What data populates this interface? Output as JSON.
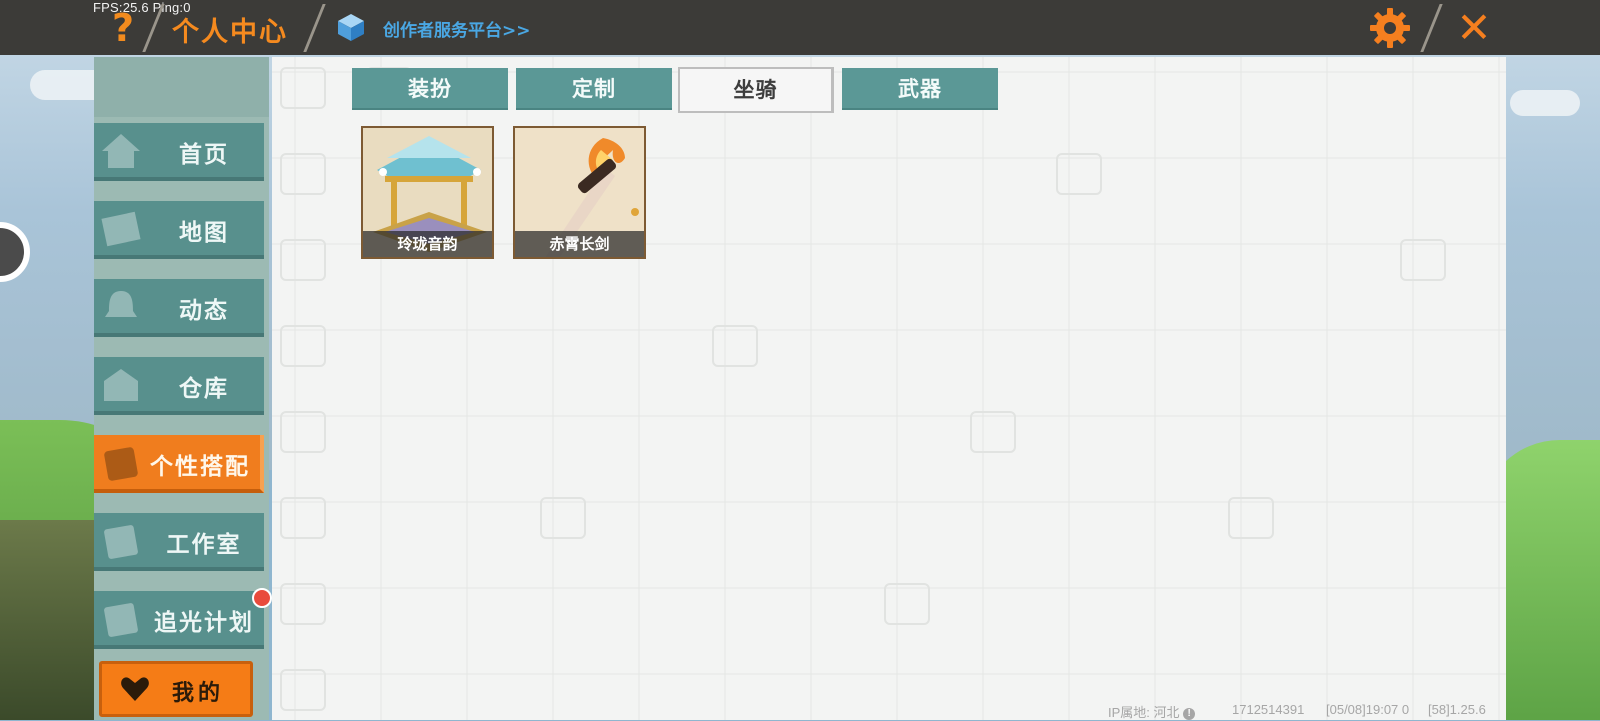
{
  "status": {
    "fps_text": "FPS:25.6  Ping:0"
  },
  "header": {
    "title": "个人中心",
    "creator_link": "创作者服务平台>>"
  },
  "sidebar": {
    "items": [
      {
        "label": "首页",
        "icon": "house-icon",
        "active": false
      },
      {
        "label": "地图",
        "icon": "picture-icon",
        "active": false
      },
      {
        "label": "动态",
        "icon": "bell-icon",
        "active": false
      },
      {
        "label": "仓库",
        "icon": "warehouse-icon",
        "active": false
      },
      {
        "label": "个性搭配",
        "icon": "avatar-icon",
        "active": true
      },
      {
        "label": "工作室",
        "icon": "studio-icon",
        "active": false
      },
      {
        "label": "追光计划",
        "icon": "light-plan-icon",
        "active": false,
        "badge": "red-dot"
      }
    ],
    "mine_button": "我的"
  },
  "tabs": [
    {
      "label": "装扮",
      "active": false
    },
    {
      "label": "定制",
      "active": false
    },
    {
      "label": "坐骑",
      "active": true
    },
    {
      "label": "武器",
      "active": false
    }
  ],
  "items": [
    {
      "name": "玲珑音韵"
    },
    {
      "name": "赤霄长剑"
    }
  ],
  "footer": {
    "ip_label": "IP属地: 河北",
    "uid": "1712514391",
    "timestamp": "[05/08]19:07 0",
    "version": "[58]1.25.6"
  },
  "colors": {
    "accent": "#f07d1e",
    "tab": "#5b9896",
    "sidebar": "#58908d",
    "topbar": "#3c3b38"
  }
}
